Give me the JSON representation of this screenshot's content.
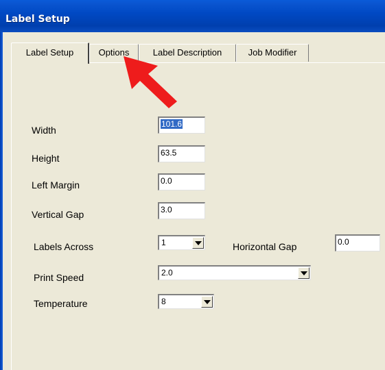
{
  "window": {
    "title": "Label Setup"
  },
  "tabs": [
    {
      "label": "Label Setup",
      "active": true
    },
    {
      "label": "Options",
      "active": false
    },
    {
      "label": "Label Description",
      "active": false
    },
    {
      "label": "Job Modifier",
      "active": false
    }
  ],
  "form": {
    "width": {
      "label": "Width",
      "value": "101.6",
      "selected": true
    },
    "height": {
      "label": "Height",
      "value": "63.5"
    },
    "left_margin": {
      "label": "Left Margin",
      "value": "0.0"
    },
    "vertical_gap": {
      "label": "Vertical Gap",
      "value": "3.0"
    },
    "labels_across": {
      "label": "Labels Across",
      "value": "1"
    },
    "horizontal_gap": {
      "label": "Horizontal Gap",
      "value": "0.0"
    },
    "print_speed": {
      "label": "Print Speed",
      "value": "2.0"
    },
    "temperature": {
      "label": "Temperature",
      "value": "8"
    }
  },
  "annotation": {
    "arrow_color": "#ee1c1c",
    "points_to": "Options tab"
  },
  "colors": {
    "titlebar": "#0049c4",
    "dialog_bg": "#ece9d8",
    "selection": "#316ac5"
  }
}
